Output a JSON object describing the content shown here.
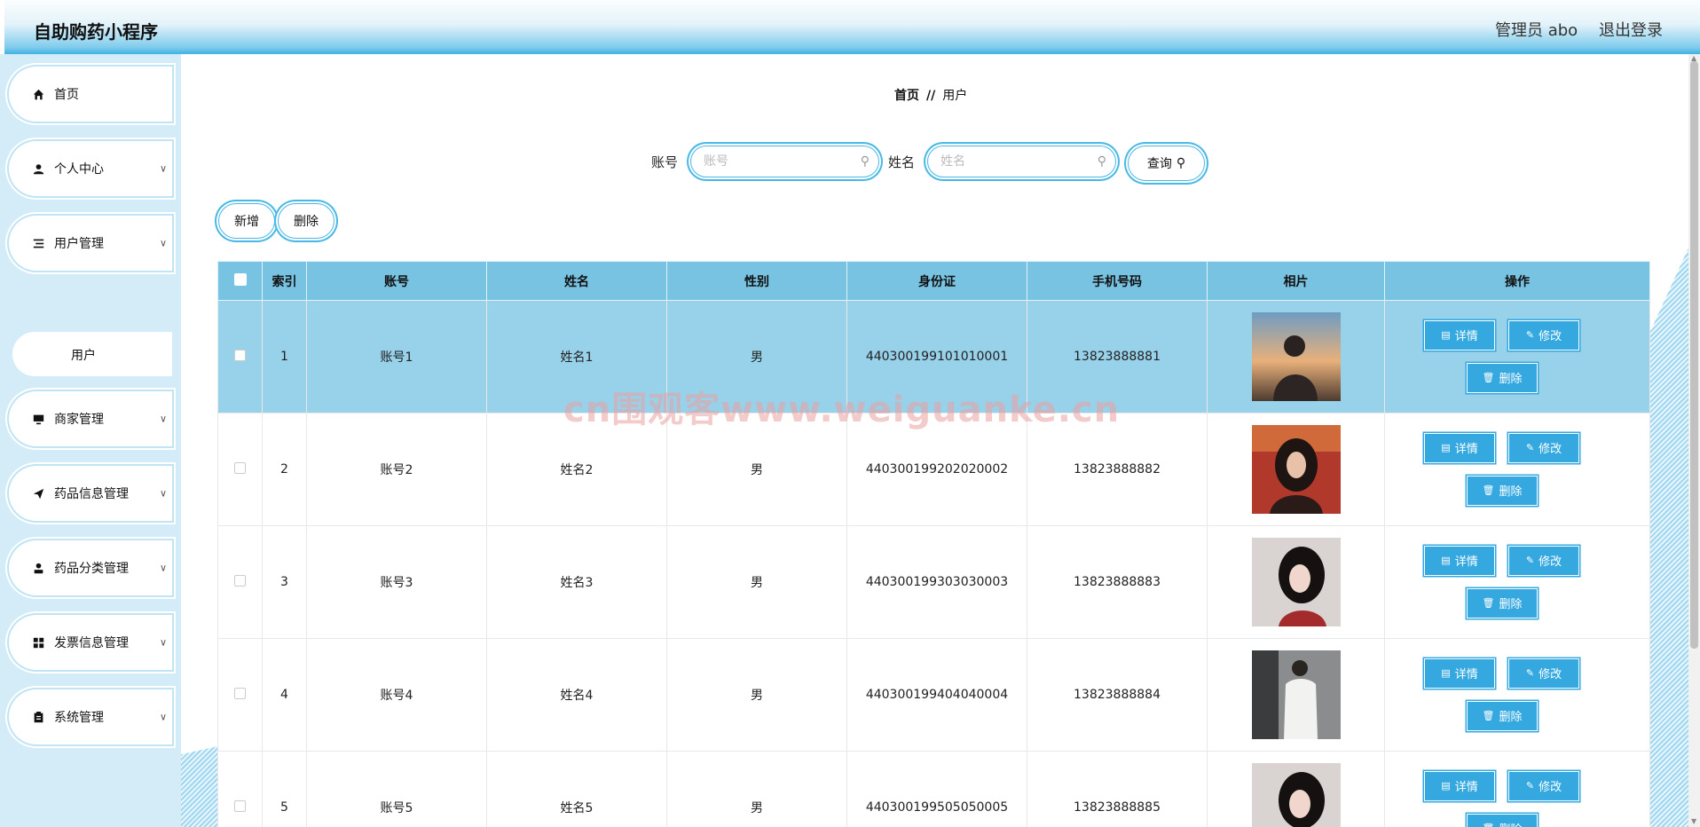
{
  "header": {
    "title": "自助购药小程序",
    "admin": "管理员 abo",
    "logout": "退出登录"
  },
  "sidebar": {
    "items": [
      {
        "label": "首页",
        "icon": "home-icon"
      },
      {
        "label": "个人中心",
        "icon": "user-icon"
      },
      {
        "label": "用户管理",
        "icon": "list-icon"
      },
      {
        "label": "商家管理",
        "icon": "monitor-icon"
      },
      {
        "label": "药品信息管理",
        "icon": "send-icon"
      },
      {
        "label": "药品分类管理",
        "icon": "person-icon"
      },
      {
        "label": "发票信息管理",
        "icon": "grid-icon"
      },
      {
        "label": "系统管理",
        "icon": "clipboard-icon"
      }
    ],
    "sub_item": "用户"
  },
  "breadcrumb": {
    "home": "首页",
    "sep": "//",
    "current": "用户"
  },
  "search": {
    "account_label": "账号",
    "account_placeholder": "账号",
    "name_label": "姓名",
    "name_placeholder": "姓名",
    "query_button": "查询"
  },
  "actions": {
    "add": "新增",
    "delete": "删除"
  },
  "table": {
    "headers": {
      "index": "索引",
      "account": "账号",
      "name": "姓名",
      "gender": "性别",
      "id_card": "身份证",
      "phone": "手机号码",
      "photo": "相片",
      "ops": "操作"
    },
    "row_buttons": {
      "detail": "详情",
      "edit": "修改",
      "delete": "删除"
    },
    "rows": [
      {
        "index": "1",
        "account": "账号1",
        "name": "姓名1",
        "gender": "男",
        "id_card": "440300199101010001",
        "phone": "13823888881"
      },
      {
        "index": "2",
        "account": "账号2",
        "name": "姓名2",
        "gender": "男",
        "id_card": "440300199202020002",
        "phone": "13823888882"
      },
      {
        "index": "3",
        "account": "账号3",
        "name": "姓名3",
        "gender": "男",
        "id_card": "440300199303030003",
        "phone": "13823888883"
      },
      {
        "index": "4",
        "account": "账号4",
        "name": "姓名4",
        "gender": "男",
        "id_card": "440300199404040004",
        "phone": "13823888884"
      },
      {
        "index": "5",
        "account": "账号5",
        "name": "姓名5",
        "gender": "男",
        "id_card": "440300199505050005",
        "phone": "13823888885"
      }
    ]
  },
  "watermark": "cn围观客www.weiguanke.cn",
  "colors": {
    "accent": "#35a9df",
    "header_blue": "#78c2e2",
    "selected_row": "#97d1ea",
    "sidebar_bg": "#d4ecf7"
  }
}
